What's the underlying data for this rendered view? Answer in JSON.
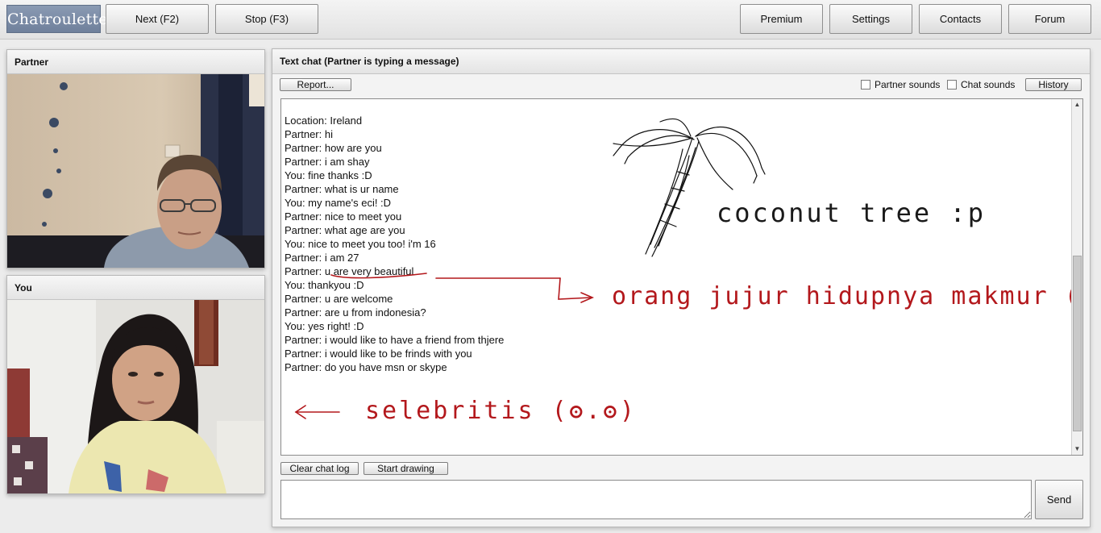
{
  "topbar": {
    "logo": "Chatroulette",
    "next_label": "Next (F2)",
    "stop_label": "Stop (F3)",
    "premium_label": "Premium",
    "settings_label": "Settings",
    "contacts_label": "Contacts",
    "forum_label": "Forum"
  },
  "partner_panel": {
    "title": "Partner"
  },
  "you_panel": {
    "title": "You"
  },
  "chat": {
    "title": "Text chat (Partner is typing a message)",
    "report_label": "Report...",
    "partner_sounds_label": "Partner sounds",
    "chat_sounds_label": "Chat sounds",
    "history_label": "History",
    "clear_label": "Clear chat log",
    "drawing_label": "Start drawing",
    "send_label": "Send",
    "input_value": "",
    "messages": [
      "Location: Ireland",
      "Partner: hi",
      "Partner: how are you",
      "Partner: i am shay",
      "You: fine thanks :D",
      "Partner: what is ur name",
      "You: my name's eci! :D",
      "Partner: nice to meet you",
      "Partner: what age are you",
      "You: nice to meet you too! i'm 16",
      "Partner: i am 27",
      "Partner: u are very beautiful",
      "You: thankyou :D",
      "Partner: u are welcome",
      "Partner: are u from indonesia?",
      "You: yes right! :D",
      "Partner: i would like to have a friend from thjere",
      "Partner: i would like to be frinds with you",
      "Partner: do you have msn or skype"
    ],
    "drawing_text": {
      "coconut": "coconut tree :p",
      "orang": "orang jujur hidupnya makmur (?)",
      "selebritis": "selebritis (ʘ.ʘ)"
    },
    "ink_colors": {
      "red": "#b3181c",
      "black": "#111111"
    }
  }
}
